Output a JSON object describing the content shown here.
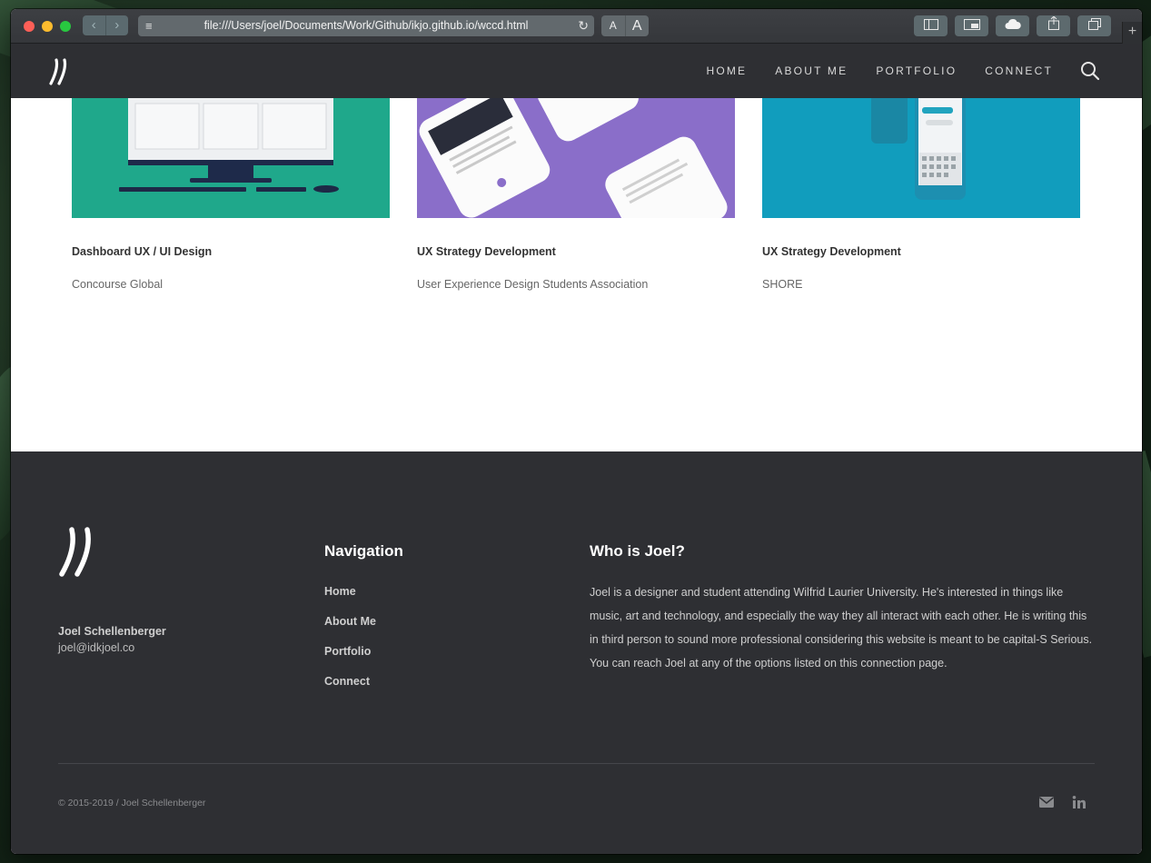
{
  "browser": {
    "url": "file:///Users/joel/Documents/Work/Github/ikjo.github.io/wccd.html",
    "font_small": "A",
    "font_large": "A"
  },
  "header": {
    "menu": [
      "HOME",
      "ABOUT ME",
      "PORTFOLIO",
      "CONNECT"
    ]
  },
  "cards": [
    {
      "title": "Dashboard UX / UI Design",
      "client": "Concourse Global",
      "bg": "#1fa88b"
    },
    {
      "title": "UX Strategy Development",
      "client": "User Experience Design Students Association",
      "bg": "#8a6ec9"
    },
    {
      "title": "UX Strategy Development",
      "client": "SHORE",
      "bg": "#119dbd"
    }
  ],
  "footer": {
    "name": "Joel Schellenberger",
    "email": "joel@idkjoel.co",
    "nav_heading": "Navigation",
    "nav_items": [
      "Home",
      "About Me",
      "Portfolio",
      "Connect"
    ],
    "about_heading": "Who is Joel?",
    "about_text": "Joel is a designer and student attending Wilfrid Laurier University. He's interested in things like music, art and technology, and especially the way they all interact with each other. He is writing this in third person to sound more professional considering this website is meant to be capital-S Serious. You can reach Joel at any of the options listed on this connection page.",
    "copyright": "© 2015-2019 / Joel Schellenberger"
  },
  "colors": {
    "header_bg": "#2e2f33",
    "footer_bg": "#2e2f33"
  }
}
